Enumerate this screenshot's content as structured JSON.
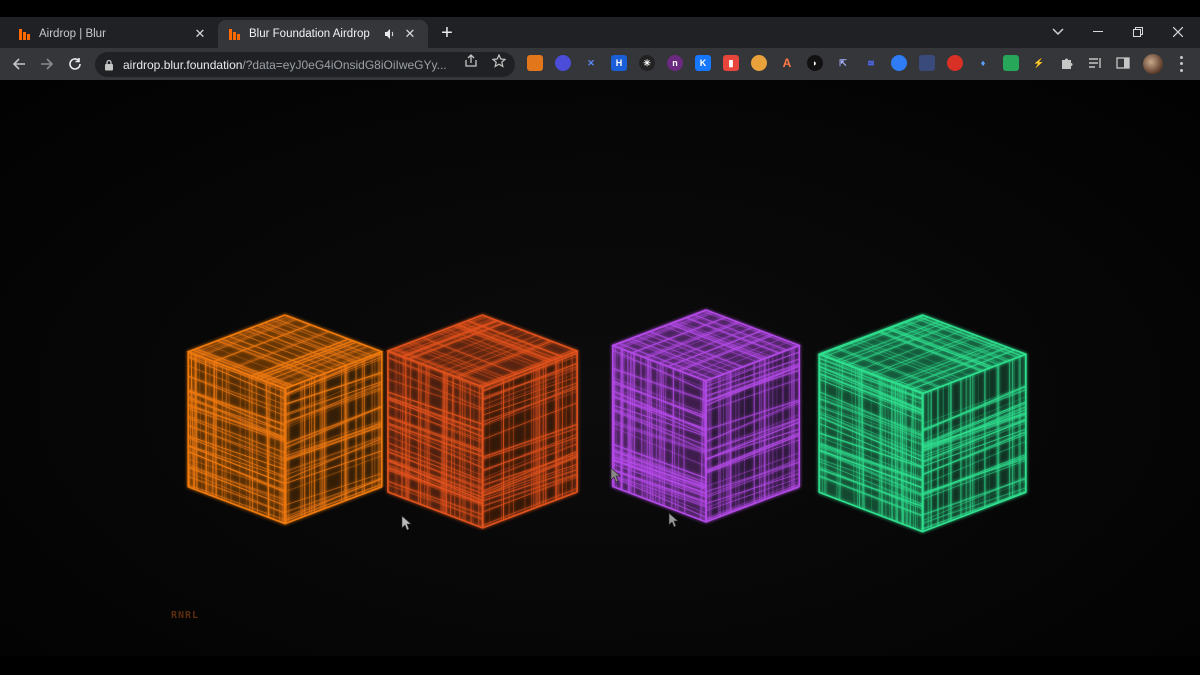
{
  "browser": {
    "tabs": [
      {
        "title": "Airdrop | Blur",
        "active": false
      },
      {
        "title": "Blur Foundation Airdrop",
        "active": true
      }
    ],
    "address_bar": {
      "host": "airdrop.blur.foundation",
      "path": "/?data=eyJ0eG4iOnsidG8iOiIweGYy..."
    }
  },
  "page": {
    "boxes": [
      {
        "name": "orange-box",
        "color": "#f07a12"
      },
      {
        "name": "red-orange-box",
        "color": "#e2521c"
      },
      {
        "name": "purple-box",
        "color": "#b44ae8"
      },
      {
        "name": "green-box",
        "color": "#2fe08f"
      }
    ],
    "corner_label": "RNRL"
  },
  "colors": {
    "tabstrip": "#202124",
    "toolbar": "#35363a",
    "page_bg": "#050505",
    "brand_orange": "#ff6a00"
  }
}
